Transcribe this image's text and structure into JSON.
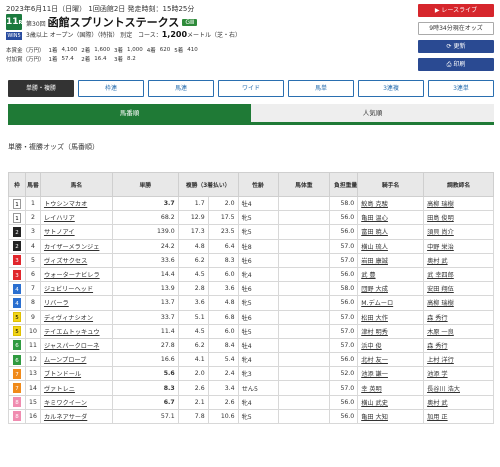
{
  "header": {
    "date_line": "2023年6月11日（日曜） 1回函館2日 発走時刻：15時25分",
    "race_number": "11",
    "race_number_unit": "R",
    "ac_badge": "WIN5",
    "kai": "第30回",
    "race_name": "函館スプリントステークス",
    "grade": "GⅢ",
    "conditions": "3歳以上 オープン（国際）（特指） 別定",
    "course_label": "コース：",
    "course_distance": "1,200",
    "course_unit": "メートル（芝・右）"
  },
  "prize": {
    "rows": [
      {
        "label": "本賞金（万円）",
        "values": [
          "1着",
          "4,100",
          "2着",
          "1,600",
          "3着",
          "1,000",
          "4着",
          "620",
          "5着",
          "410"
        ]
      },
      {
        "label": "付加賞（万円）",
        "values": [
          "1着",
          "57.4",
          "2着",
          "16.4",
          "3着",
          "8.2",
          "",
          "",
          "",
          ""
        ]
      }
    ]
  },
  "right_buttons": {
    "race_live": "レースライブ",
    "status": "9時34分現在オッズ",
    "update": "更新",
    "print": "印刷"
  },
  "bet_tabs": [
    "単勝・複勝",
    "枠連",
    "馬連",
    "ワイド",
    "馬単",
    "3連複",
    "3連単"
  ],
  "sort_tabs": [
    "馬番順",
    "人気順"
  ],
  "section_title": "単勝・複勝オッズ（馬番順）",
  "table": {
    "headers": [
      "枠",
      "馬番",
      "馬名",
      "単勝",
      "複勝（3着払い）",
      "",
      "性齢",
      "馬体重",
      "負担重量",
      "騎手名",
      "調教師名"
    ],
    "rows": [
      {
        "waku": "1",
        "num": "1",
        "horse": "トウシンマカオ",
        "tan": "3.7",
        "fl": "1.7",
        "fh": "2.0",
        "sex": "牡4",
        "load": "58.0",
        "jockey": "鮫島 克駿",
        "trainer": "高柳 瑞樹",
        "hot": true
      },
      {
        "waku": "1",
        "num": "2",
        "horse": "レイハリア",
        "tan": "68.2",
        "fl": "12.9",
        "fh": "17.5",
        "sex": "牝5",
        "load": "56.0",
        "jockey": "亀田 温心",
        "trainer": "田島 俊明",
        "hot": false
      },
      {
        "waku": "2",
        "num": "3",
        "horse": "サトノアイ",
        "tan": "139.0",
        "fl": "17.3",
        "fh": "23.5",
        "sex": "牝5",
        "load": "56.0",
        "jockey": "富田 暁人",
        "trainer": "須貝 尚介",
        "hot": false
      },
      {
        "waku": "2",
        "num": "4",
        "horse": "カイザーメランジェ",
        "tan": "24.2",
        "fl": "4.8",
        "fh": "6.4",
        "sex": "牡8",
        "load": "57.0",
        "jockey": "横山 琉人",
        "trainer": "中野 栄治",
        "hot": false
      },
      {
        "waku": "3",
        "num": "5",
        "horse": "ヴィズサクセス",
        "tan": "33.6",
        "fl": "6.2",
        "fh": "8.3",
        "sex": "牡6",
        "load": "57.0",
        "jockey": "岩田 康誠",
        "trainer": "奥村 武",
        "hot": false
      },
      {
        "waku": "3",
        "num": "6",
        "horse": "ウォーターナビレラ",
        "tan": "14.4",
        "fl": "4.5",
        "fh": "6.0",
        "sex": "牝4",
        "load": "56.0",
        "jockey": "武 豊",
        "trainer": "武 幸四郎",
        "hot": false
      },
      {
        "waku": "4",
        "num": "7",
        "horse": "ジュビリーヘッド",
        "tan": "13.9",
        "fl": "2.8",
        "fh": "3.6",
        "sex": "牡6",
        "load": "58.0",
        "jockey": "団野 大成",
        "trainer": "安田 翔伍",
        "hot": false
      },
      {
        "waku": "4",
        "num": "8",
        "horse": "リバーラ",
        "tan": "13.7",
        "fl": "3.6",
        "fh": "4.8",
        "sex": "牝5",
        "load": "56.0",
        "jockey": "M.デムーロ",
        "trainer": "高柳 瑞樹",
        "hot": false
      },
      {
        "waku": "5",
        "num": "9",
        "horse": "ディヴィナシオン",
        "tan": "33.7",
        "fl": "5.1",
        "fh": "6.8",
        "sex": "牡6",
        "load": "57.0",
        "jockey": "松田 大作",
        "trainer": "森 秀行",
        "hot": false
      },
      {
        "waku": "5",
        "num": "10",
        "horse": "テイエムトッキュウ",
        "tan": "11.4",
        "fl": "4.5",
        "fh": "6.0",
        "sex": "牡5",
        "load": "57.0",
        "jockey": "津村 明秀",
        "trainer": "木原 一良",
        "hot": false
      },
      {
        "waku": "6",
        "num": "11",
        "horse": "ジャスパークローネ",
        "tan": "27.8",
        "fl": "6.2",
        "fh": "8.4",
        "sex": "牡4",
        "load": "57.0",
        "jockey": "浜中 俊",
        "trainer": "森 秀行",
        "hot": false
      },
      {
        "waku": "6",
        "num": "12",
        "horse": "ムーンプローブ",
        "tan": "16.6",
        "fl": "4.1",
        "fh": "5.4",
        "sex": "牝4",
        "load": "56.0",
        "jockey": "北村 友一",
        "trainer": "上村 洋行",
        "hot": false
      },
      {
        "waku": "7",
        "num": "13",
        "horse": "ブトンドール",
        "tan": "5.6",
        "fl": "2.0",
        "fh": "2.4",
        "sex": "牝3",
        "load": "52.0",
        "jockey": "池添 謙一",
        "trainer": "池添 学",
        "hot": true
      },
      {
        "waku": "7",
        "num": "14",
        "horse": "ヴァトレニ",
        "tan": "8.3",
        "fl": "2.6",
        "fh": "3.4",
        "sex": "せん5",
        "load": "57.0",
        "jockey": "幸 英明",
        "trainer": "長谷川 浩大",
        "hot": true
      },
      {
        "waku": "8",
        "num": "15",
        "horse": "キミワクイーン",
        "tan": "6.7",
        "fl": "2.1",
        "fh": "2.6",
        "sex": "牝4",
        "load": "56.0",
        "jockey": "横山 武史",
        "trainer": "奥村 武",
        "hot": true
      },
      {
        "waku": "8",
        "num": "16",
        "horse": "カルネアサーダ",
        "tan": "57.1",
        "fl": "7.8",
        "fh": "10.6",
        "sex": "牝5",
        "load": "56.0",
        "jockey": "亀田 大知",
        "trainer": "加用 正",
        "hot": false
      }
    ]
  },
  "colors": {
    "accent_green": "#1f7a36",
    "red": "#d6262c",
    "link_blue": "#2a5aa8",
    "nav_blue": "#2a4a92"
  }
}
